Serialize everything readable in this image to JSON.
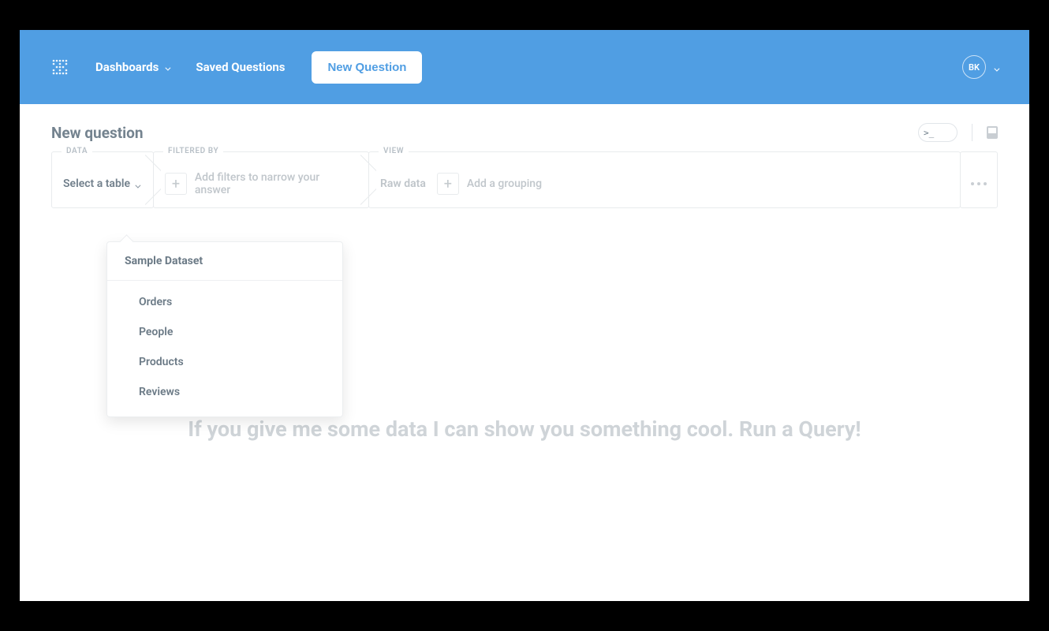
{
  "colors": {
    "accent": "#509ee3"
  },
  "topnav": {
    "dashboards": "Dashboards",
    "saved_questions": "Saved Questions",
    "new_question": "New Question",
    "user_initials": "BK"
  },
  "page": {
    "title": "New question"
  },
  "query": {
    "data_label": "DATA",
    "data_select": "Select a table",
    "filter_label": "FILTERED BY",
    "filter_hint": "Add filters to narrow your answer",
    "view_label": "VIEW",
    "view_raw": "Raw data",
    "view_grouping": "Add a grouping"
  },
  "dropdown": {
    "header": "Sample Dataset",
    "items": [
      "Orders",
      "People",
      "Products",
      "Reviews"
    ]
  },
  "empty_state": "If you give me some data I can show you something cool. Run a Query!"
}
